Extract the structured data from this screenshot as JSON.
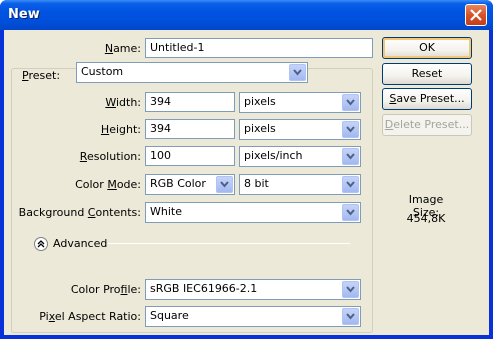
{
  "window": {
    "title": "New"
  },
  "form": {
    "name": {
      "label": "Name:",
      "value": "Untitled-1"
    },
    "preset": {
      "label": "Preset:",
      "value": "Custom"
    },
    "width": {
      "label": "Width:",
      "value": "394",
      "unit": "pixels"
    },
    "height": {
      "label": "Height:",
      "value": "394",
      "unit": "pixels"
    },
    "resolution": {
      "label": "Resolution:",
      "value": "100",
      "unit": "pixels/inch"
    },
    "color_mode": {
      "label": "Color Mode:",
      "value": "RGB Color",
      "depth": "8 bit"
    },
    "background": {
      "label": "Background Contents:",
      "value": "White"
    },
    "advanced": {
      "label": "Advanced"
    },
    "color_profile": {
      "label": "Color Profile:",
      "value": "sRGB IEC61966-2.1"
    },
    "pixel_aspect": {
      "label": "Pixel Aspect Ratio:",
      "value": "Square"
    }
  },
  "buttons": {
    "ok": "OK",
    "reset": "Reset",
    "save_preset": "Save Preset...",
    "delete_preset": "Delete Preset..."
  },
  "image_size": {
    "label": "Image Size:",
    "value": "454,8K"
  },
  "icons": {
    "close": "close-icon",
    "dropdown": "chevron-down-icon",
    "collapse": "double-chevron-up-icon"
  },
  "colors": {
    "titlebar": "#0054e3",
    "dialog_bg": "#ece9d8",
    "input_border": "#7f9db9",
    "close_button": "#d7542a"
  }
}
